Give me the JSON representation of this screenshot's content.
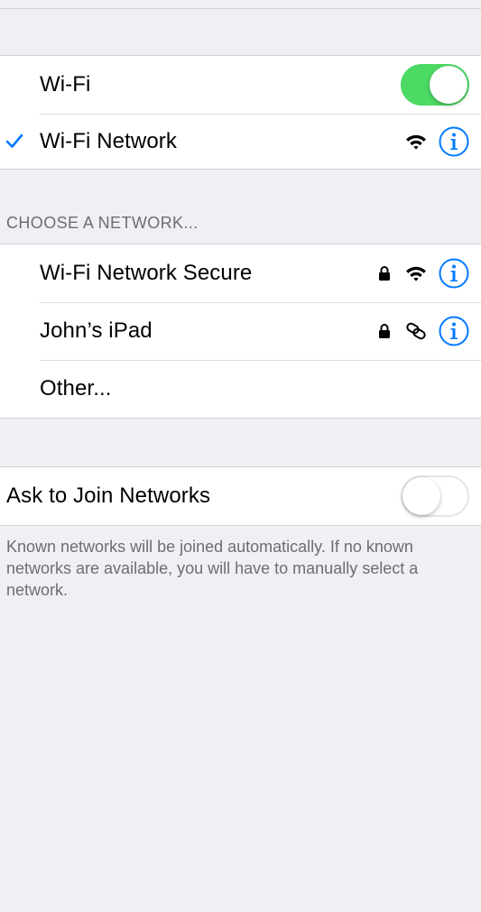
{
  "wifi": {
    "label": "Wi-Fi",
    "enabled": true
  },
  "current_network": {
    "name": "Wi-Fi Network",
    "connected": true
  },
  "section_header": "CHOOSE A NETWORK...",
  "networks": [
    {
      "name": "Wi-Fi Network Secure",
      "icon": "wifi-icon",
      "secured": true
    },
    {
      "name": "John’s iPad",
      "icon": "personal-hotspot-link-icon",
      "secured": true
    },
    {
      "name": "Other..."
    }
  ],
  "ask_to_join": {
    "label": "Ask to Join Networks",
    "enabled": false
  },
  "footer_note": "Known networks will be joined automatically. If no known networks are available, you will have to manually select a network.",
  "colors": {
    "accent": "#007aff",
    "toggle_on": "#4cd964",
    "background": "#efeff4"
  }
}
